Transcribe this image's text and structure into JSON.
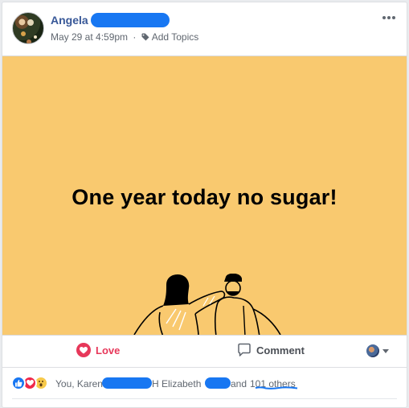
{
  "post": {
    "author_first_name": "Angela",
    "timestamp": "May 29 at 4:59pm",
    "separator": "·",
    "add_topics_label": "Add Topics",
    "more_icon": "more-horizontal-icon"
  },
  "content": {
    "banner_text": "One year today no sugar!",
    "banner_color": "#f9c96f"
  },
  "actions": {
    "love_label": "Love",
    "comment_label": "Comment"
  },
  "reactions": {
    "icons": [
      "like-icon",
      "love-icon",
      "wow-icon"
    ],
    "prefix": "You, Karen",
    "middle": "H Elizabeth",
    "and_label": "and",
    "others_label": "101 others"
  },
  "colors": {
    "link_blue": "#385898",
    "love_red": "#e7385a",
    "redaction_blue": "#1877f2"
  }
}
